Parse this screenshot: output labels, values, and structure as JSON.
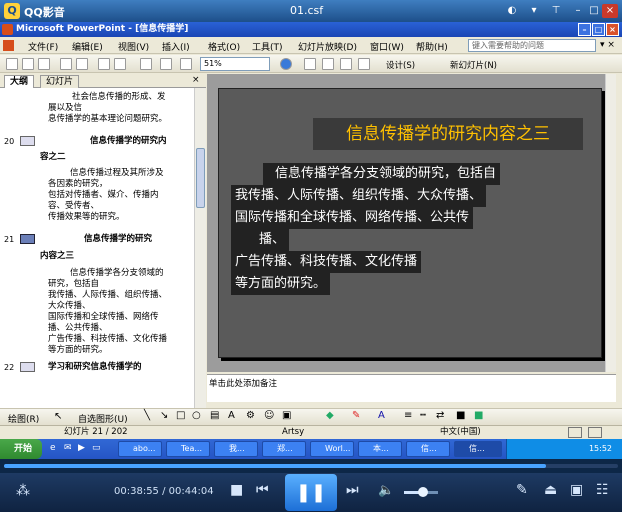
{
  "player": {
    "name": "QQ影音",
    "file": "01.csf",
    "time": "00:38:55 / 00:44:04",
    "progress": 0.883
  },
  "ppt": {
    "title": "Microsoft PowerPoint - [信息传播学]",
    "menu": [
      "文件(F)",
      "编辑(E)",
      "视图(V)",
      "插入(I)",
      "格式(O)",
      "工具(T)",
      "幻灯片放映(D)",
      "窗口(W)",
      "帮助(H)"
    ],
    "help_placeholder": "键入需要帮助的问题",
    "zoom": "51%",
    "design": "设计(S)",
    "new_slide": "新幻灯片(N)",
    "tabs": [
      "大纲",
      "幻灯片"
    ],
    "outline": {
      "l1": "社会信息传播的形成、发",
      "l2": "展以及信",
      "l3": "息传播学的基本理论问题研究。",
      "n20": "20",
      "t20a": "信息传播学的研究内",
      "t20b": "容之二",
      "p1": "信息传播过程及其所涉及",
      "p2": "各因素的研究，",
      "p3": "包括对传播者、媒介、传播内",
      "p4": "容、受传者、",
      "p5": "传播效果等的研究。",
      "n21": "21",
      "t21a": "信息传播学的研究",
      "t21b": "内容之三",
      "q1": "信息传播学各分支领域的",
      "q2": "研究，包括自",
      "q3": "我传播、人际传播、组织传播、",
      "q4": "大众传播、",
      "q5": "国际传播和全球传播、网络传",
      "q6": "播、公共传播、",
      "q7": "广告传播、科技传播、文化传播",
      "q8": "等方面的研究。",
      "n22": "22",
      "t22": "学习和研究信息传播学的"
    },
    "slide": {
      "title": "信息传播学的研究内容之三",
      "lines": [
        "信息传播学各分支领域的研究，包括自",
        "我传播、人际传播、组织传播、大众传播、",
        "国际传播和全球传播、网络传播、公共传",
        "播、",
        "广告传播、科技传播、文化传播",
        "等方面的研究。"
      ]
    },
    "notes": "单击此处添加备注",
    "draw": "绘图(R)",
    "autoshape": "自选图形(U)",
    "status": {
      "slide": "幻灯片 21 / 202",
      "template": "Artsy",
      "lang": "中文(中国)"
    }
  },
  "taskbar": {
    "start": "开始",
    "tasks": [
      "abo...",
      "Tea...",
      "我...",
      "郑...",
      "Worl...",
      "本...",
      "信...",
      "信..."
    ],
    "clock": "15:52"
  }
}
